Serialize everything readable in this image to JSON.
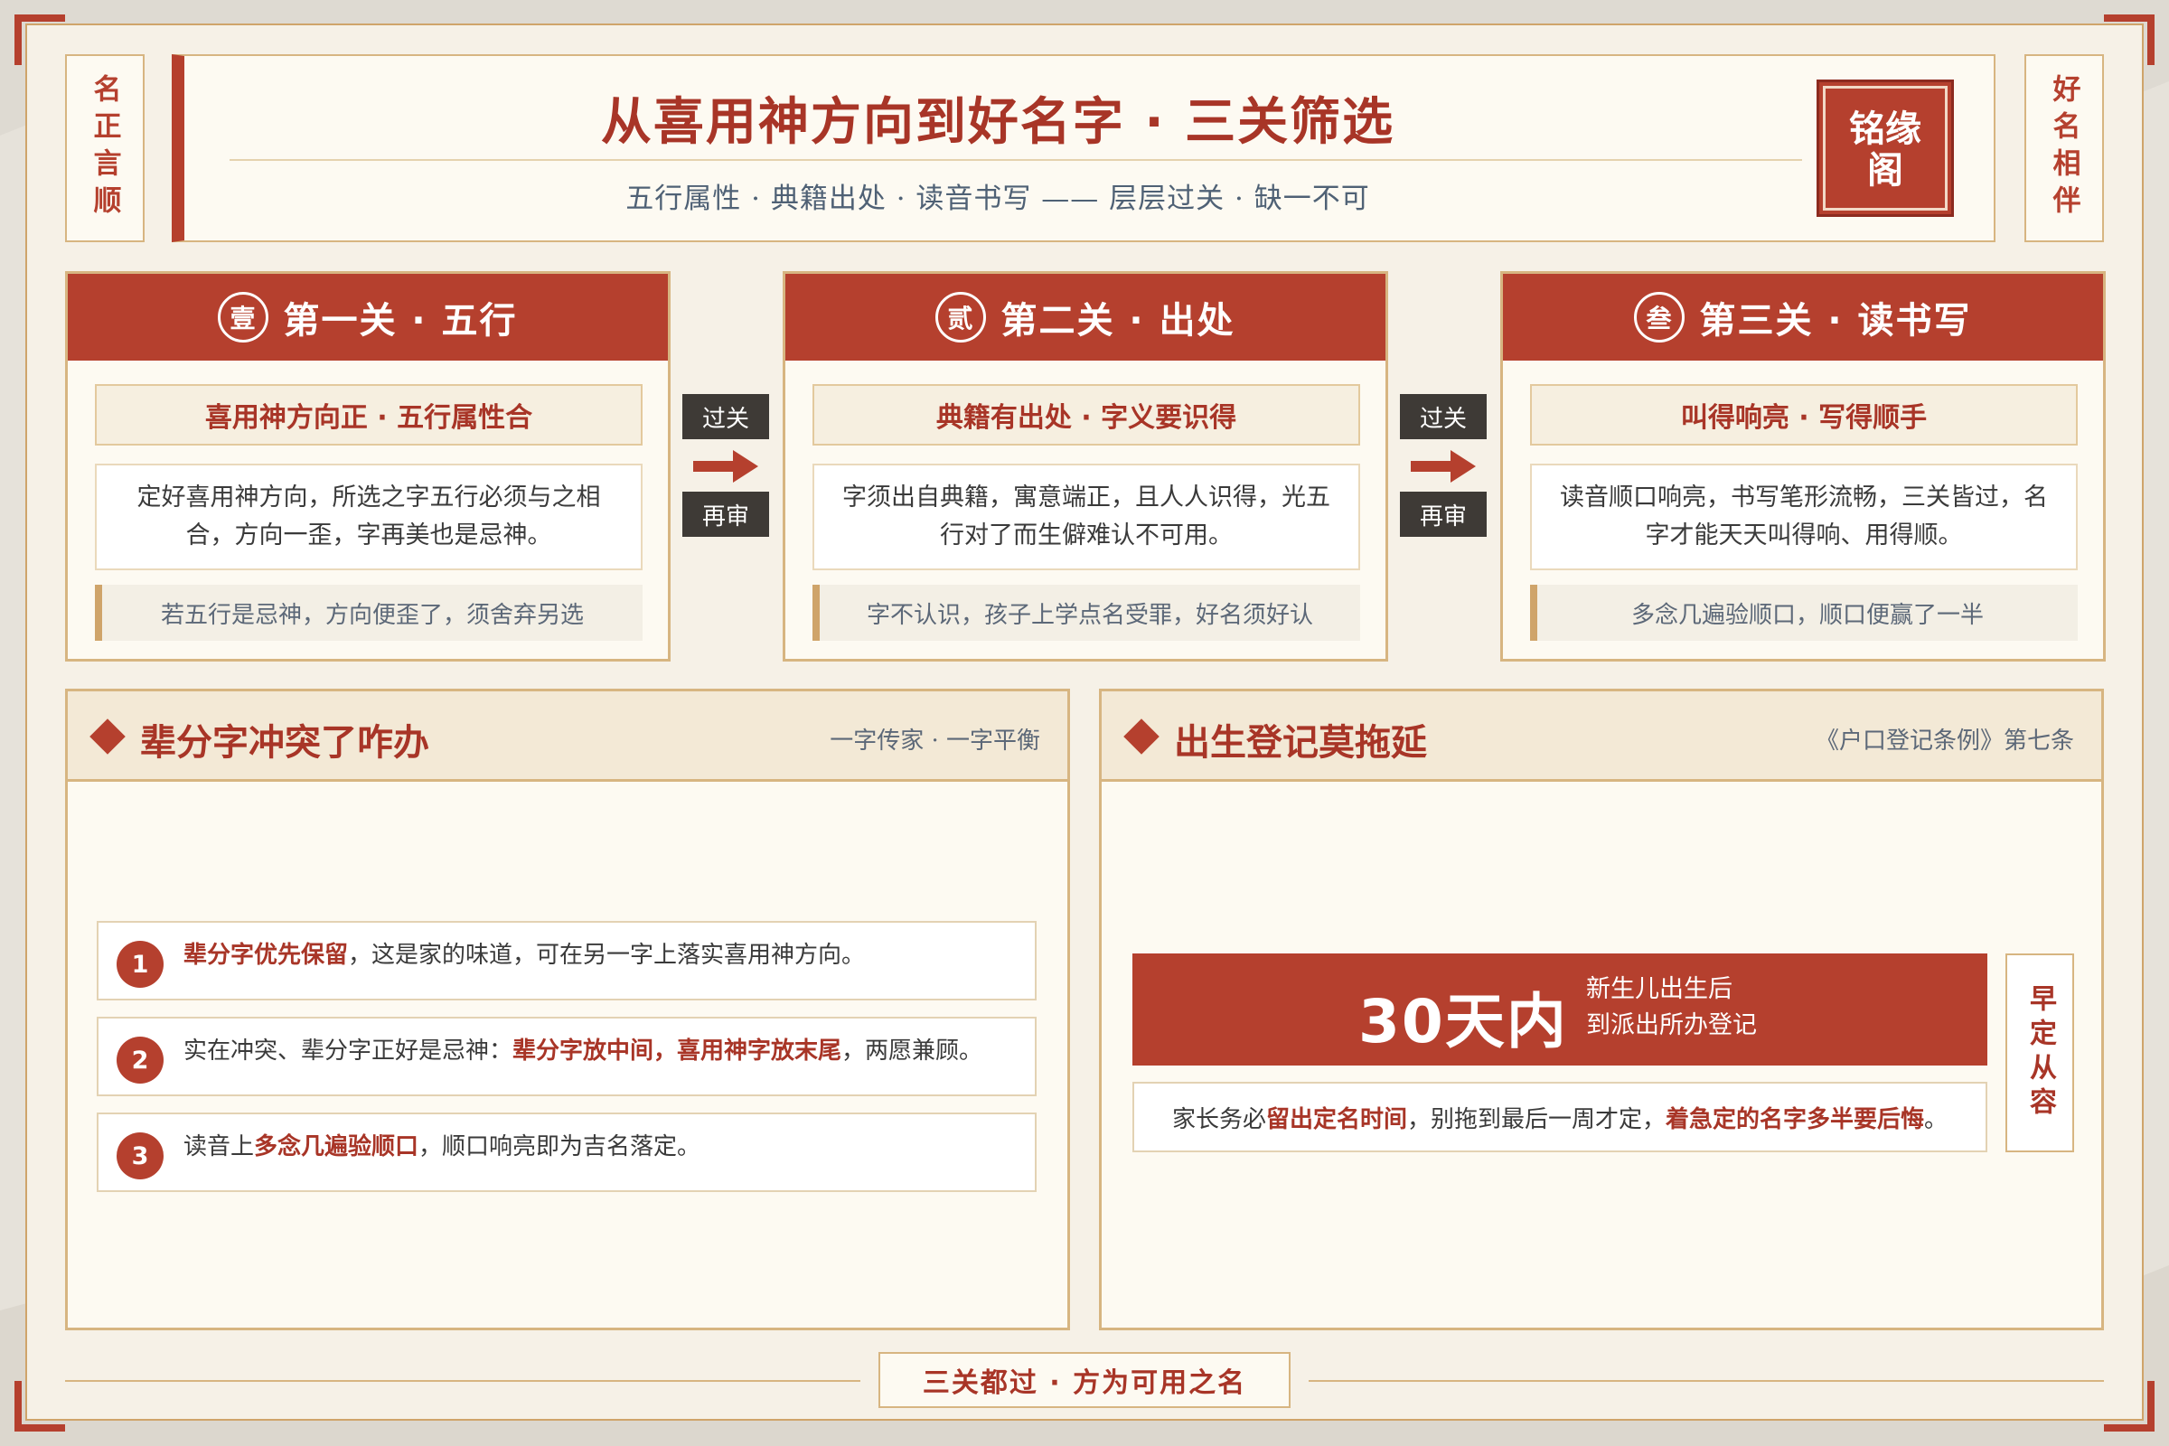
{
  "side_tags": {
    "left": "名正言顺",
    "right": "好名相伴"
  },
  "header": {
    "title": "从喜用神方向到好名字 · 三关筛选",
    "subtitle": "五行属性 · 典籍出处 · 读音书写 —— 层层过关 · 缺一不可",
    "seal": {
      "line1": "铭缘",
      "line2": "阁"
    }
  },
  "gates": [
    {
      "num": "壹",
      "title": "第一关 · 五行",
      "sub": "喜用神方向正 · 五行属性合",
      "body": "定好喜用神方向，所选之字五行必须与之相合，方向一歪，字再美也是忌神。",
      "note": "若五行是忌神，方向便歪了，须舍弃另选"
    },
    {
      "num": "贰",
      "title": "第二关 · 出处",
      "sub": "典籍有出处 · 字义要识得",
      "body": "字须出自典籍，寓意端正，且人人识得，光五行对了而生僻难认不可用。",
      "note": "字不认识，孩子上学点名受罪，好名须好认"
    },
    {
      "num": "叁",
      "title": "第三关 · 读书写",
      "sub": "叫得响亮 · 写得顺手",
      "body": "读音顺口响亮，书写笔形流畅，三关皆过，名字才能天天叫得响、用得顺。",
      "note": "多念几遍验顺口，顺口便赢了一半"
    }
  ],
  "connectors": {
    "top": "过关",
    "bottom": "再审"
  },
  "left_panel": {
    "title": "辈分字冲突了咋办",
    "note": "一字传家 · 一字平衡",
    "items": [
      {
        "num": "1",
        "hl1": "辈分字优先保留",
        "t1": "，这是家的味道，可在另一字上落实喜用神方向。"
      },
      {
        "num": "2",
        "t0": "实在冲突、辈分字正好是忌神：",
        "hl1": "辈分字放中间，喜用神字放末尾",
        "t1": "，两愿兼顾。"
      },
      {
        "num": "3",
        "t0": "读音上",
        "hl1": "多念几遍验顺口",
        "t1": "，顺口响亮即为吉名落定。"
      }
    ]
  },
  "right_panel": {
    "title": "出生登记莫拖延",
    "note": "《户口登记条例》第七条",
    "banner_big": "30天内",
    "banner_line1": "新生儿出生后",
    "banner_line2": "到派出所办登记",
    "reg_t0": "家长务必",
    "reg_hl1": "留出定名时间",
    "reg_t1": "，别拖到最后一周才定，",
    "reg_hl2": "着急定的名字多半要后悔",
    "reg_t2": "。",
    "vert_tag": "早定从容"
  },
  "footer": "三关都过 · 方为可用之名",
  "colors": {
    "accent": "#b5402e",
    "gold": "#cfa46a",
    "paper": "#fdfaf2",
    "background": "#f6f1e7"
  }
}
